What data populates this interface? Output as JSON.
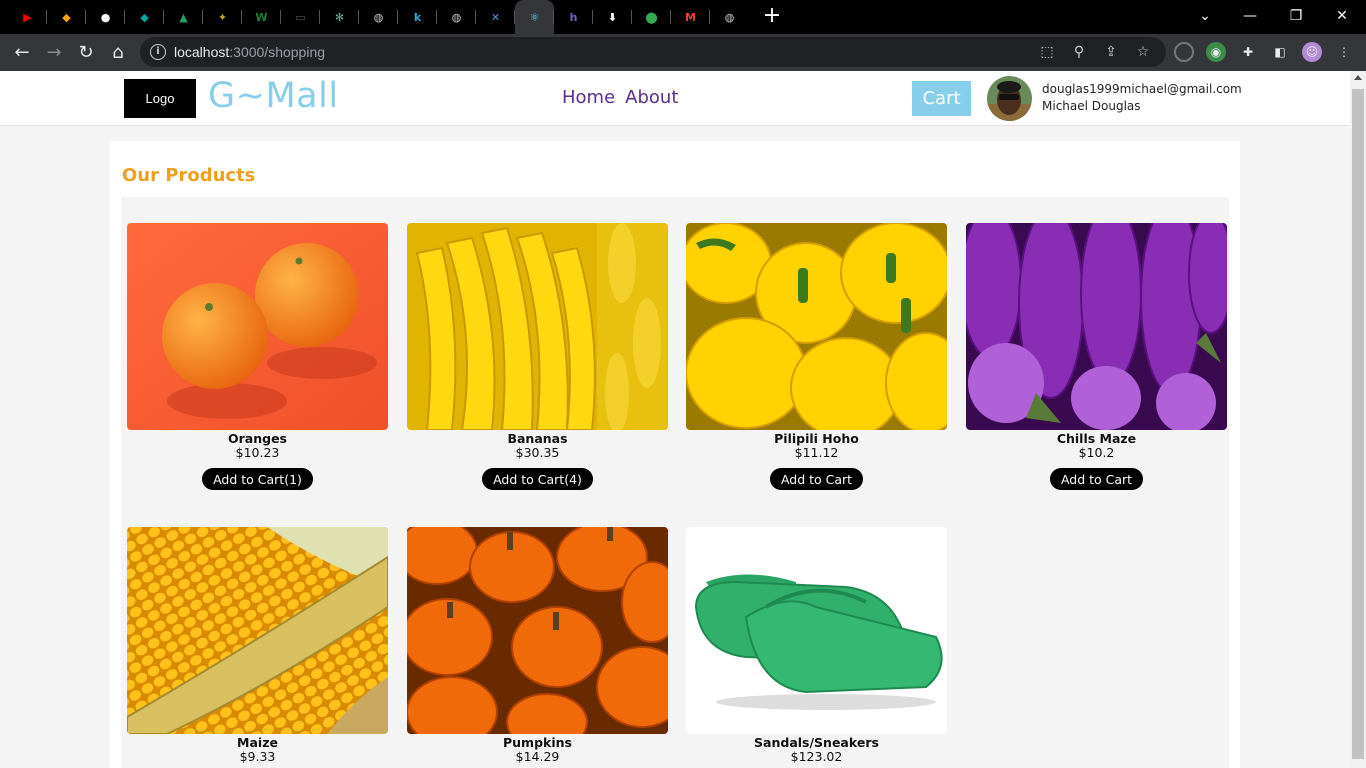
{
  "browser": {
    "tabs": [
      {
        "icon": "youtube-icon",
        "color": "#ff0000",
        "glyph": "▶"
      },
      {
        "icon": "firebase-icon",
        "color": "#ffa000",
        "glyph": "◆"
      },
      {
        "icon": "github-icon",
        "color": "#ffffff",
        "glyph": "●"
      },
      {
        "icon": "diamond-icon",
        "color": "#00a6a0",
        "glyph": "◆"
      },
      {
        "icon": "google-drive-icon",
        "color": "#1fa463",
        "glyph": "▲"
      },
      {
        "icon": "crest-icon",
        "color": "#c9a227",
        "glyph": "✦"
      },
      {
        "icon": "webflow-icon",
        "color": "#1a7f3c",
        "glyph": "W"
      },
      {
        "icon": "window-icon",
        "color": "#555555",
        "glyph": "▭"
      },
      {
        "icon": "chatgpt-icon",
        "color": "#74aa9c",
        "glyph": "✻"
      },
      {
        "icon": "globe-icon",
        "color": "#cccccc",
        "glyph": "◍"
      },
      {
        "icon": "k-icon",
        "color": "#2aa7e0",
        "glyph": "k"
      },
      {
        "icon": "globe-icon",
        "color": "#cccccc",
        "glyph": "◍"
      },
      {
        "icon": "bird-icon",
        "color": "#5a8fd6",
        "glyph": "✕"
      },
      {
        "icon": "react-icon",
        "color": "#61dafb",
        "glyph": "⚛"
      },
      {
        "icon": "heroku-icon",
        "color": "#7b5cc5",
        "glyph": "h"
      },
      {
        "icon": "download-icon",
        "color": "#ffffff",
        "glyph": "⬇"
      },
      {
        "icon": "maps-pin-icon",
        "color": "#34a853",
        "glyph": "⬤"
      },
      {
        "icon": "gmail-icon",
        "color": "#ea4335",
        "glyph": "M"
      },
      {
        "icon": "globe-icon",
        "color": "#cccccc",
        "glyph": "◍"
      }
    ],
    "url_host": "localhost",
    "url_path": ":3000/shopping"
  },
  "header": {
    "logo_text": "Logo",
    "brand": "G~Mall",
    "nav": [
      "Home",
      "About"
    ],
    "cart_label": "Cart",
    "user_email": "douglas1999michael@gmail.com",
    "user_name": "Michael Douglas"
  },
  "main": {
    "title": "Our Products",
    "products": [
      {
        "name": "Oranges",
        "price": "$10.23",
        "button": "Add to Cart(1)",
        "image": "oranges"
      },
      {
        "name": "Bananas",
        "price": "$30.35",
        "button": "Add to Cart(4)",
        "image": "bananas"
      },
      {
        "name": "Pilipili Hoho",
        "price": "$11.12",
        "button": "Add to Cart",
        "image": "peppers"
      },
      {
        "name": "Chills Maze",
        "price": "$10.2",
        "button": "Add to Cart",
        "image": "eggplants"
      },
      {
        "name": "Maize",
        "price": "$9.33",
        "button": "",
        "image": "maize"
      },
      {
        "name": "Pumpkins",
        "price": "$14.29",
        "button": "",
        "image": "pumpkins"
      },
      {
        "name": "Sandals/Sneakers",
        "price": "$123.02",
        "button": "",
        "image": "clogs"
      }
    ]
  },
  "colors": {
    "brand": "#87ceeb",
    "nav_link": "#5b2d8e",
    "title": "#f0a020"
  }
}
